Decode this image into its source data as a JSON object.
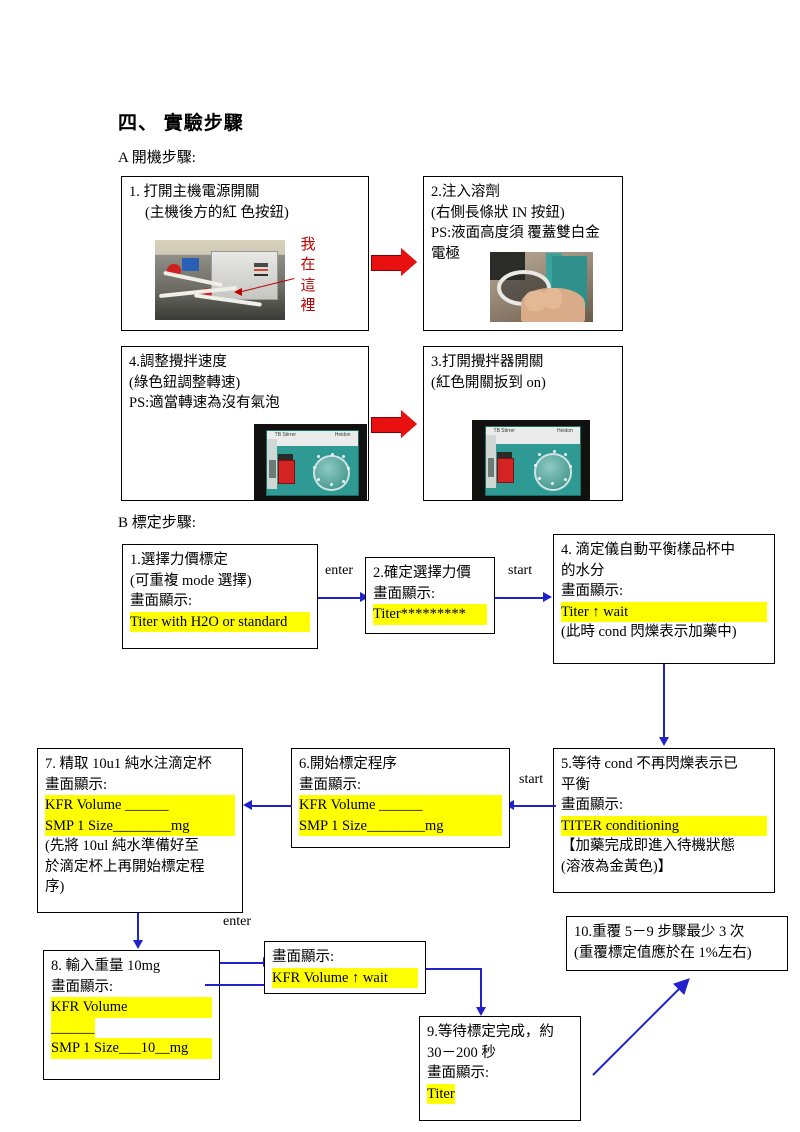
{
  "headings": {
    "section_four": "四、   實驗步驟",
    "part_a": "A 開機步驟:",
    "part_b": "B 標定步驟:"
  },
  "part_a_boxes": [
    {
      "id": "box-1",
      "lines": [
        "1.  打開主機電源開關",
        "(主機後方的紅 色按鈕)"
      ],
      "annotation": "我在這裡",
      "photo": "instrument-rear-photo"
    },
    {
      "id": "box-2",
      "lines": [
        "2.注入溶劑",
        "(右側長條狀 IN 按鈕)",
        "PS:液面高度須 覆蓋雙白金",
        "電極"
      ],
      "photo": "beaker-hand-photo"
    },
    {
      "id": "box-4",
      "lines": [
        "4.調整攪拌速度",
        "(綠色鈕調整轉速)",
        "PS:適當轉速為沒有氣泡"
      ],
      "photo": "stirrer-photo"
    },
    {
      "id": "box-3",
      "lines": [
        "3.打開攪拌器開關",
        "(紅色開關扳到 on)"
      ],
      "photo": "stirrer-photo"
    }
  ],
  "part_b_boxes": {
    "b1": {
      "lines": [
        "1.選擇力價標定",
        "(可重複 mode 選擇)",
        "畫面顯示:"
      ],
      "highlight": "Titer with H2O or standard"
    },
    "b2": {
      "lines": [
        "2.確定選擇力價",
        "畫面顯示:"
      ],
      "highlight": "Titer*********"
    },
    "b4": {
      "lines": [
        "4. 滴定儀自動平衡樣品杯中",
        "的水分",
        "畫面顯示:"
      ],
      "highlight": "Titer ↑ wait",
      "note": "(此時 cond 閃爍表示加藥中)"
    },
    "b5": {
      "lines": [
        "5.等待 cond 不再閃爍表示已",
        "平衡",
        "畫面顯示:"
      ],
      "highlight": "TITER conditioning",
      "notes": [
        "【加藥完成即進入待機狀態",
        "(溶液為金黃色)】"
      ]
    },
    "b6": {
      "lines": [
        "6.開始標定程序",
        "畫面顯示:"
      ],
      "highlight1": "KFR Volume  ______",
      "highlight2": "SMP 1 Size________mg"
    },
    "b7": {
      "lines": [
        "7. 精取 10u1 純水注滴定杯",
        "畫面顯示:"
      ],
      "highlight1": "KFR Volume  ______",
      "highlight2": "SMP 1 Size________mg",
      "notes": [
        "(先將 10ul 純水準備好至",
        "於滴定杯上再開始標定程",
        "序)"
      ]
    },
    "b8": {
      "lines": [
        "8. 輸入重量 10mg",
        "畫面顯示:"
      ],
      "highlight1": "KFR Volume",
      "highlight2": "______",
      "highlight3": "SMP 1 Size___10__mg"
    },
    "b8b": {
      "lines": [
        "畫面顯示:"
      ],
      "highlight": "KFR Volume ↑ wait"
    },
    "b9": {
      "lines": [
        "9.等待標定完成，約",
        "30－200 秒",
        "畫面顯示:"
      ],
      "highlight": "Titer"
    },
    "b10": {
      "lines": [
        "10.重覆 5－9 步驟最少 3 次",
        "(重覆標定值應於在 1%左右)"
      ]
    }
  },
  "connector_labels": {
    "enter_1": "enter",
    "start_1": "start",
    "start_2": "start",
    "enter_2": "enter"
  },
  "colors": {
    "highlight": "#ffff00",
    "connector": "#2222cc",
    "red_arrow": "#e81010",
    "red_text": "#c00000"
  }
}
